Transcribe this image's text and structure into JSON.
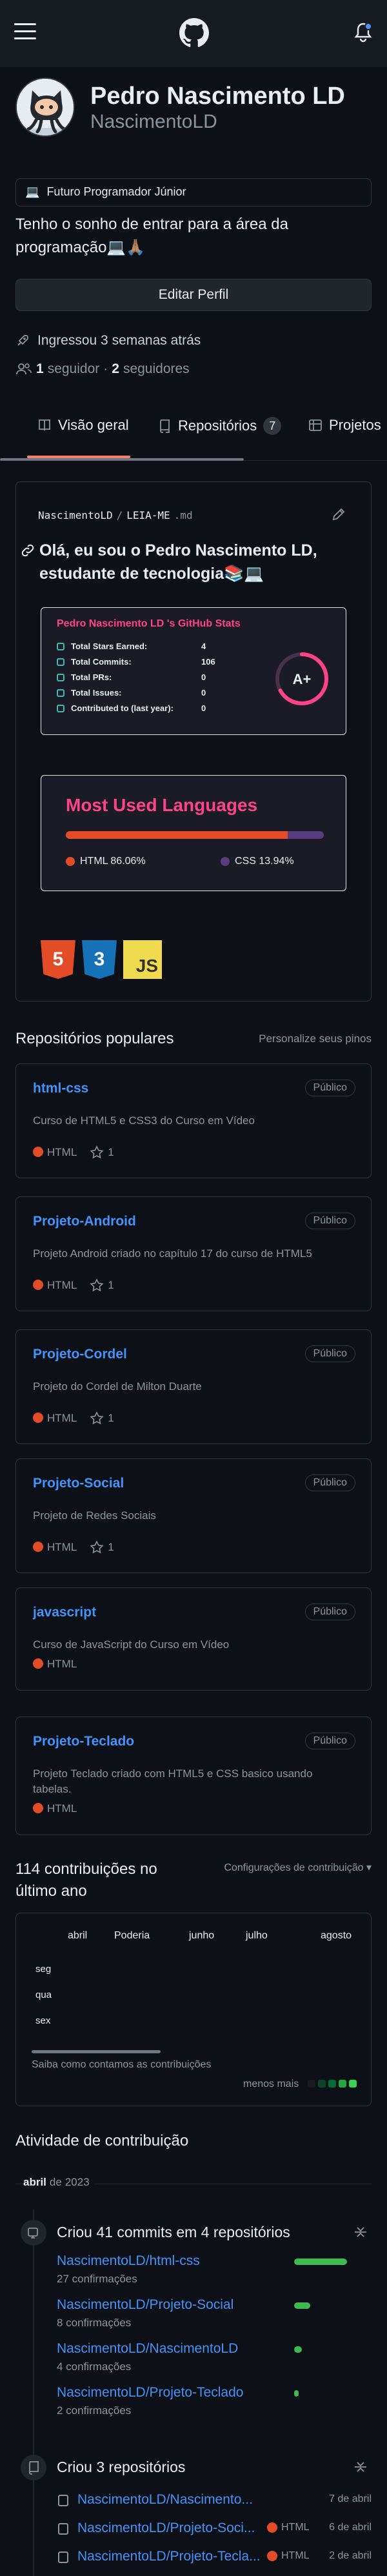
{
  "profile": {
    "name": "Pedro Nascimento LD",
    "login": "NascimentoLD",
    "status": "Futuro Programador Júnior",
    "status_emoji": "💻",
    "bio": "Tenho o sonho de entrar para a área da programação💻🙏🏽",
    "edit_button": "Editar Perfil",
    "joined": "Ingressou 3 semanas atrás",
    "followers_count": "1",
    "followers_label": "seguidor",
    "separator": "·",
    "following_count": "2",
    "following_label": "seguidores"
  },
  "tabs": [
    {
      "label": "Visão geral",
      "active": true
    },
    {
      "label": "Repositórios",
      "count": "7"
    },
    {
      "label": "Projetos"
    }
  ],
  "readme": {
    "path_user": "NascimentoLD",
    "path_sep": "/",
    "path_file": "LEIA-ME",
    "path_ext": ".md",
    "heading": "Olá, eu sou o Pedro Nascimento LD, estudante de tecnologia📚💻",
    "stats": {
      "title": "Pedro Nascimento LD 's GitHub Stats",
      "rows": [
        {
          "label": "Total Stars Earned:",
          "value": "4"
        },
        {
          "label": "Total Commits:",
          "value": "106"
        },
        {
          "label": "Total PRs:",
          "value": "0"
        },
        {
          "label": "Total Issues:",
          "value": "0"
        },
        {
          "label": "Contributed to (last year):",
          "value": "0"
        }
      ],
      "grade": "A+"
    },
    "languages": {
      "title": "Most Used Languages",
      "items": [
        {
          "label": "HTML 86.06%",
          "fraction": 0.8606,
          "color": "#e34c26"
        },
        {
          "label": "CSS 13.94%",
          "fraction": 0.1394,
          "color": "#563d7c"
        }
      ]
    },
    "tech_badges": [
      "5",
      "3",
      "JS"
    ]
  },
  "popular": {
    "title": "Repositórios populares",
    "customize": "Personalize seus pinos",
    "repos": [
      {
        "name": "html-css",
        "visibility": "Público",
        "desc": "Curso de HTML5 e CSS3 do Curso em Vídeo",
        "lang": "HTML",
        "stars": "1"
      },
      {
        "name": "Projeto-Android",
        "visibility": "Público",
        "desc": "Projeto Android criado no capítulo 17 do curso de HTML5",
        "lang": "HTML",
        "stars": "1"
      },
      {
        "name": "Projeto-Cordel",
        "visibility": "Público",
        "desc": "Projeto do Cordel de Milton Duarte",
        "lang": "HTML",
        "stars": "1"
      },
      {
        "name": "Projeto-Social",
        "visibility": "Público",
        "desc": "Projeto de Redes Sociais",
        "lang": "HTML",
        "stars": "1"
      },
      {
        "name": "javascript",
        "visibility": "Público",
        "desc": "Curso de JavaScript do Curso em Vídeo",
        "lang": "HTML",
        "stars": ""
      },
      {
        "name": "Projeto-Teclado",
        "visibility": "Público",
        "desc": "Projeto Teclado criado com HTML5 e CSS basico usando tabelas.",
        "lang": "HTML",
        "stars": ""
      }
    ]
  },
  "contributions": {
    "title": "114 contribuições no último ano",
    "settings": "Configurações de contribuição ▾",
    "months": [
      "abril",
      "Poderia",
      "junho",
      "julho",
      "agosto"
    ],
    "days": [
      "seg",
      "qua",
      "sex"
    ],
    "learn": "Saiba como contamos as contribuições",
    "less_more": "menos mais",
    "legend_colors": [
      "#161b22",
      "#0e4429",
      "#006d32",
      "#26a641",
      "#39d353"
    ]
  },
  "activity": {
    "title": "Atividade de contribuição",
    "month": "abril",
    "year_prefix": "de",
    "year": "2023",
    "commits_title": "Criou 41 commits em 4 repositórios",
    "commits": [
      {
        "repo": "NascimentoLD/html-css",
        "count": "27 confirmações",
        "fraction": 1.0
      },
      {
        "repo": "NascimentoLD/Projeto-Social",
        "count": "8 confirmações",
        "fraction": 0.3
      },
      {
        "repo": "NascimentoLD/NascimentoLD",
        "count": "4 confirmações",
        "fraction": 0.15
      },
      {
        "repo": "NascimentoLD/Projeto-Teclado",
        "count": "2 confirmações",
        "fraction": 0.08
      }
    ],
    "repos_title": "Criou 3 repositórios",
    "created": [
      {
        "repo": "NascimentoLD/Nascimento...",
        "lang": "",
        "date": "7 de abril"
      },
      {
        "repo": "NascimentoLD/Projeto-Soci...",
        "lang": "HTML",
        "date": "6 de abril"
      },
      {
        "repo": "NascimentoLD/Projeto-Tecla...",
        "lang": "HTML",
        "date": "2 de abril"
      }
    ]
  }
}
